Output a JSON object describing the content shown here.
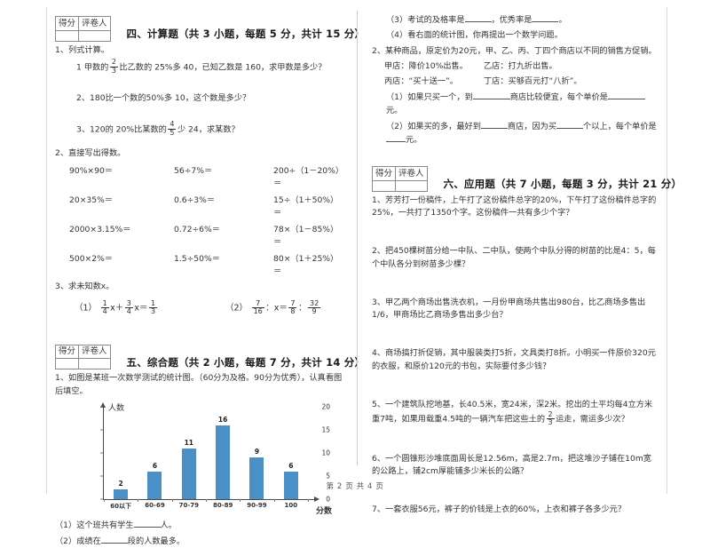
{
  "document": {
    "footer": "第 2 页 共 4 页",
    "score_box": {
      "score_label": "得分",
      "grader_label": "评卷人"
    },
    "accent_color": "#4a8fc6"
  },
  "left_column": {
    "section4": {
      "title": "四、计算题（共 3 小题，每题 5 分，共计 15 分）",
      "q1": {
        "label": "1、列式计算。",
        "item1_pre": "1 甲数的",
        "item1_frac": {
          "num": "2",
          "den": "3"
        },
        "item1_post": "比乙数的 25%多 40，已知乙数是 160，求甲数是多少？",
        "item2": "2、180比一个数的50%多 10，这个数是多少？",
        "item3_pre": "3、120的 20%比某数的",
        "item3_frac": {
          "num": "4",
          "den": "5"
        },
        "item3_post": "少 24，求某数？"
      },
      "q2": {
        "label": "2、直接写出得数。",
        "cells": [
          "90%×90＝",
          "56÷7%＝",
          "200÷（1－20%）＝",
          "20×35%＝",
          "0.6÷3%＝",
          "15÷（1＋50%）＝",
          "2000×3.15%＝",
          "0.72÷6%＝",
          "78×（1－85%）＝",
          "500×2%＝",
          "1.5÷50%＝",
          "80×（1＋25%）＝"
        ]
      },
      "q3": {
        "label": "3、求未知数x。",
        "eq1_prefix": "（1）",
        "eq1_f1": {
          "num": "1",
          "den": "4"
        },
        "eq1_mid": "x＋",
        "eq1_f2": {
          "num": "3",
          "den": "4"
        },
        "eq1_mid2": "x＝",
        "eq1_f3": {
          "num": "1",
          "den": "3"
        },
        "eq2_prefix": "（2）",
        "eq2_f1": {
          "num": "7",
          "den": "16"
        },
        "eq2_mid": "：x＝",
        "eq2_f2": {
          "num": "7",
          "den": "8"
        },
        "eq2_mid2": "：",
        "eq2_f3": {
          "num": "32",
          "den": "9"
        }
      }
    },
    "section5": {
      "title": "五、综合题（共 2 小题，每题 7 分，共计 14 分）",
      "q1_label": "1、如图是某班一次数学测试的统计图。（60分为及格。90分为优秀），认真看图后填空。",
      "sub1_a": "（1）这个班共有学生",
      "sub1_b": "人。",
      "sub2_a": "（2）成绩在",
      "sub2_b": "段的人数最多。"
    }
  },
  "right_column": {
    "section5_cont": {
      "sub3_a": "（3）考试的及格率是",
      "sub3_b": "，优秀率是",
      "sub3_c": "。",
      "sub4": "（4）看右面的统计图，你再提出一个数学问题。",
      "q2_line1": "2、某种商品，原定价为20元，甲、乙、丙、丁四个商店以不同的销售方促销。",
      "q2_line2a": "甲店：降价10%出售。",
      "q2_line2b": "乙店：打九折出售。",
      "q2_line3a": "丙店：“买十送一”。",
      "q2_line3b": "丁店：买够百元打“八折”。",
      "q2_sub1_a": "（1）如果只买一个，到",
      "q2_sub1_b": "商店比较便宜，每个单价是",
      "q2_sub1_c": "元。",
      "q2_sub2_a": "（2）如果买的多，最好到",
      "q2_sub2_b": "商店，因为买",
      "q2_sub2_c": "个以上，每个单价是",
      "q2_sub2_d": "元。"
    },
    "section6": {
      "title": "六、应用题（共 7 小题，每题 3 分，共计 21 分）",
      "items": [
        "1、芳芳打一份稿件，上午打了这份稿件总字的20%，下午打了这份稿件总字的25%，一共打了1350个字。这份稿件一共有多少个字？",
        "2、把450棵树苗分给一中队、二中队，使两个中队分得的树苗的比是4：5，每个中队各分到树苗多少棵？",
        "3、甲乙两个商场出售洗衣机，一月份甲商场共售出980台，比乙商场多售出1/6，甲商场比乙商场多售出多少台？",
        "4、商场搞打折促销，其中服装类打5折，文具类打8折。小明买一件原价320元的衣服，和原价120元的书包，实际要付多少钱？"
      ],
      "item5_pre": "5、一个建筑队挖地基，长40.5米，宽24米，深2米。挖出的土平均每4立方米重7吨，如果用载重4.5吨的一辆汽车把这些土的",
      "item5_frac": {
        "num": "2",
        "den": "3"
      },
      "item5_post": "运走，需运多少次？",
      "item6": "6、一个圆锥形沙堆底面周长是12.56m，高是2.7m，把这堆沙子铺在10m宽的公路上，铺2cm厚能铺多少米长的公路？",
      "item7": "7、一套衣服56元，裤子的价钱是上衣的60%，上衣和裤子各多少元？"
    }
  },
  "chart_data": {
    "type": "bar",
    "title": "",
    "xlabel": "分数",
    "ylabel": "人数",
    "categories": [
      "60以下",
      "60-69",
      "70-79",
      "80-89",
      "90-99",
      "100"
    ],
    "values": [
      2,
      6,
      11,
      16,
      9,
      6
    ],
    "yticks": [
      0,
      5,
      10,
      15,
      20
    ],
    "ylim": [
      0,
      20
    ],
    "grid": false,
    "legend": "none",
    "bar_color": "#4a8fc6"
  }
}
